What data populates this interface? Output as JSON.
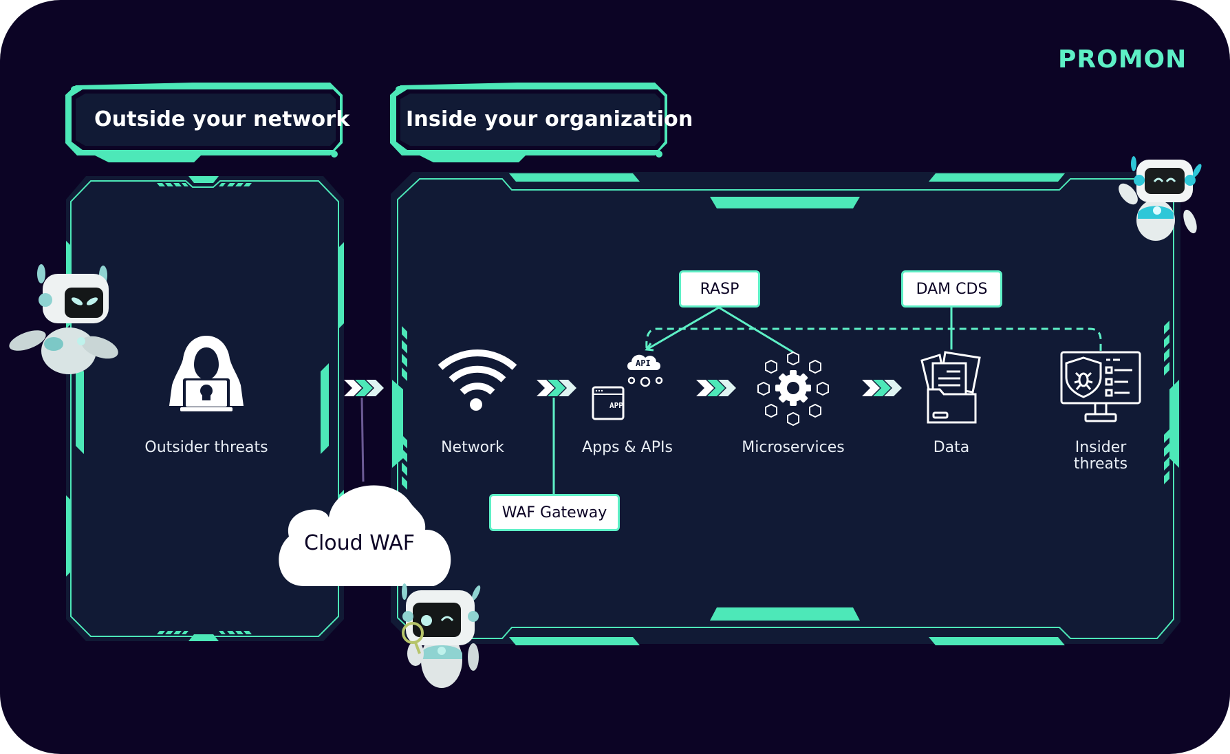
{
  "brand": {
    "name": "PROMON",
    "color": "#5ef0c6"
  },
  "colors": {
    "background": "#0c0425",
    "panel": "#111a35",
    "accent": "#4de8b8",
    "icon": "#ffffff",
    "tag_bg": "#ffffff",
    "tag_text": "#0c0425"
  },
  "sections": {
    "outside": {
      "title": "Outside your network"
    },
    "inside": {
      "title": "Inside your organization"
    }
  },
  "nodes": {
    "outsider": {
      "label": "Outsider threats",
      "icon": "hooded-hacker-laptop-skull"
    },
    "network": {
      "label": "Network",
      "icon": "wifi"
    },
    "apps": {
      "label": "Apps & APIs",
      "icon": "app-window-api-cloud",
      "api_text": "API",
      "app_text": "APP"
    },
    "microservices": {
      "label": "Microservices",
      "icon": "gear-with-cubes"
    },
    "data": {
      "label": "Data",
      "icon": "folder-documents"
    },
    "insider": {
      "label_line1": "Insider",
      "label_line2": "threats",
      "icon": "monitor-shield-bug-checklist"
    }
  },
  "protections": {
    "cloud_waf": {
      "label": "Cloud WAF"
    },
    "waf_gateway": {
      "label": "WAF Gateway"
    },
    "rasp": {
      "label": "RASP"
    },
    "dam_cds": {
      "label": "DAM CDS"
    }
  },
  "decorations": [
    "robot-mascot-left",
    "robot-mascot-top-right",
    "robot-mascot-magnifier-bottom"
  ]
}
